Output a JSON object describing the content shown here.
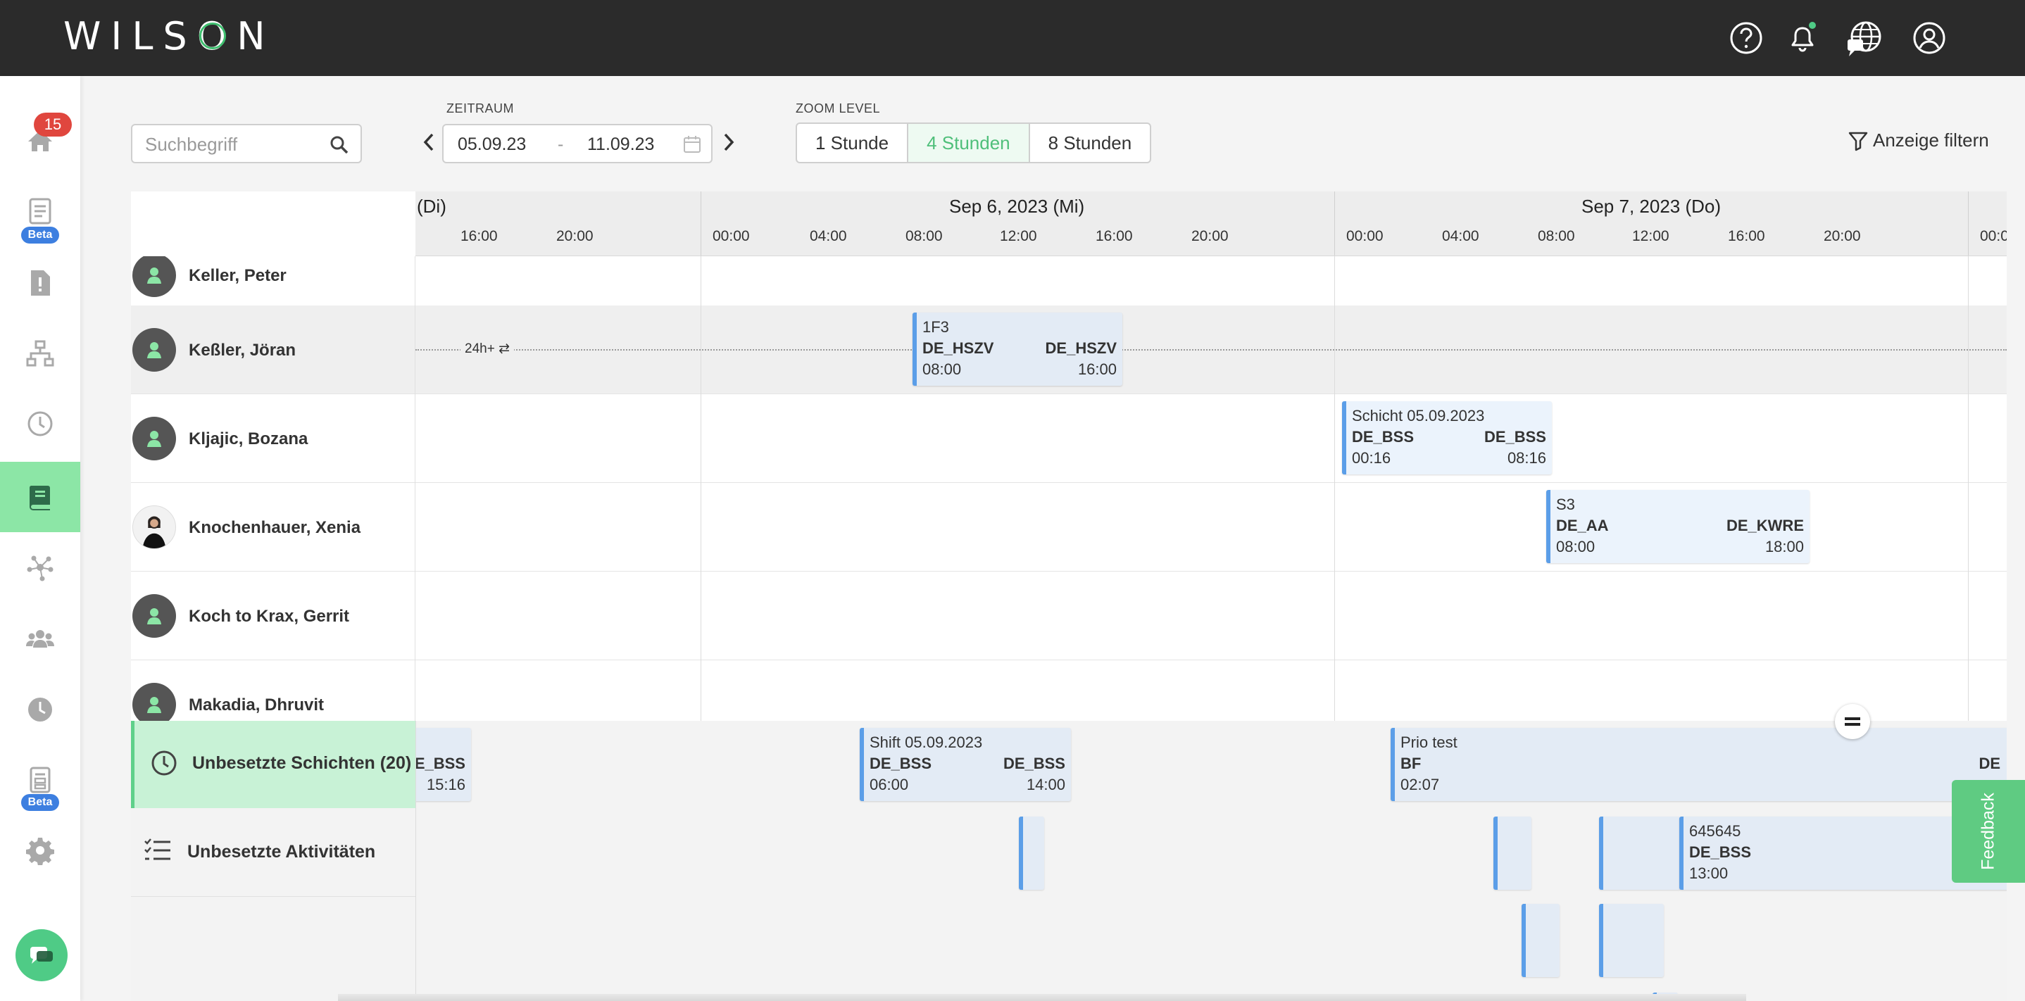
{
  "app": {
    "logo": "WILSON"
  },
  "nav": {
    "reports_badge": "15",
    "beta_label": "Beta",
    "beta_label_2": "Beta"
  },
  "toolbar": {
    "search_placeholder": "Suchbegriff",
    "zeitraum_label": "ZEITRAUM",
    "date_from": "05.09.23",
    "date_sep": "-",
    "date_to": "11.09.23",
    "zoom_label": "ZOOM LEVEL",
    "zoom_options": [
      "1 Stunde",
      "4 Stunden",
      "8 Stunden"
    ],
    "zoom_selected": "4 Stunden",
    "filter_label": "Anzeige filtern"
  },
  "timeline": {
    "days": [
      "(Di)",
      "Sep 6, 2023 (Mi)",
      "Sep 7, 2023 (Do)"
    ],
    "hours_day0": [
      "16:00",
      "20:00"
    ],
    "hours_day1": [
      "00:00",
      "04:00",
      "08:00",
      "12:00",
      "16:00",
      "20:00"
    ],
    "hours_day2": [
      "00:00",
      "04:00",
      "08:00",
      "12:00",
      "16:00",
      "20:00"
    ],
    "hours_day3": [
      "00:0"
    ]
  },
  "employees": [
    {
      "name": "Keller, Peter"
    },
    {
      "name": "Keßler, Jöran"
    },
    {
      "name": "Kljajic, Bozana"
    },
    {
      "name": "Knochenhauer, Xenia"
    },
    {
      "name": "Koch to Krax, Gerrit"
    },
    {
      "name": "Makadia, Dhruvit"
    }
  ],
  "row_tag": {
    "text": "24h+ ⇄"
  },
  "shifts": {
    "s1": {
      "title": "1F3",
      "from_loc": "DE_HSZV",
      "to_loc": "DE_HSZV",
      "start": "08:00",
      "end": "16:00"
    },
    "s2": {
      "title": "Schicht 05.09.2023",
      "from_loc": "DE_BSS",
      "to_loc": "DE_BSS",
      "start": "00:16",
      "end": "08:16"
    },
    "s3": {
      "title": "S3",
      "from_loc": "DE_AA",
      "to_loc": "DE_KWRE",
      "start": "08:00",
      "end": "18:00"
    },
    "u0": {
      "to_loc": "DE_BSS",
      "end": "15:16"
    },
    "u1": {
      "title": "Shift 05.09.2023",
      "from_loc": "DE_BSS",
      "to_loc": "DE_BSS",
      "start": "06:00",
      "end": "14:00"
    },
    "u2": {
      "title": "Prio test",
      "from_loc": "BF",
      "to_loc": "DE",
      "start": "02:07"
    },
    "a1": {
      "title": "645645",
      "from_loc": "DE_BSS",
      "start": "13:00"
    }
  },
  "unassigned": {
    "shifts_label": "Unbesetzte Schichten (20)",
    "activities_label": "Unbesetzte Aktivitäten"
  },
  "feedback": {
    "label": "Feedback"
  },
  "colors": {
    "accent_green": "#4fbf7a",
    "shift_blue": "#5b9ee8",
    "topbar": "#2b2b2b",
    "badge_red": "#e0463e"
  }
}
